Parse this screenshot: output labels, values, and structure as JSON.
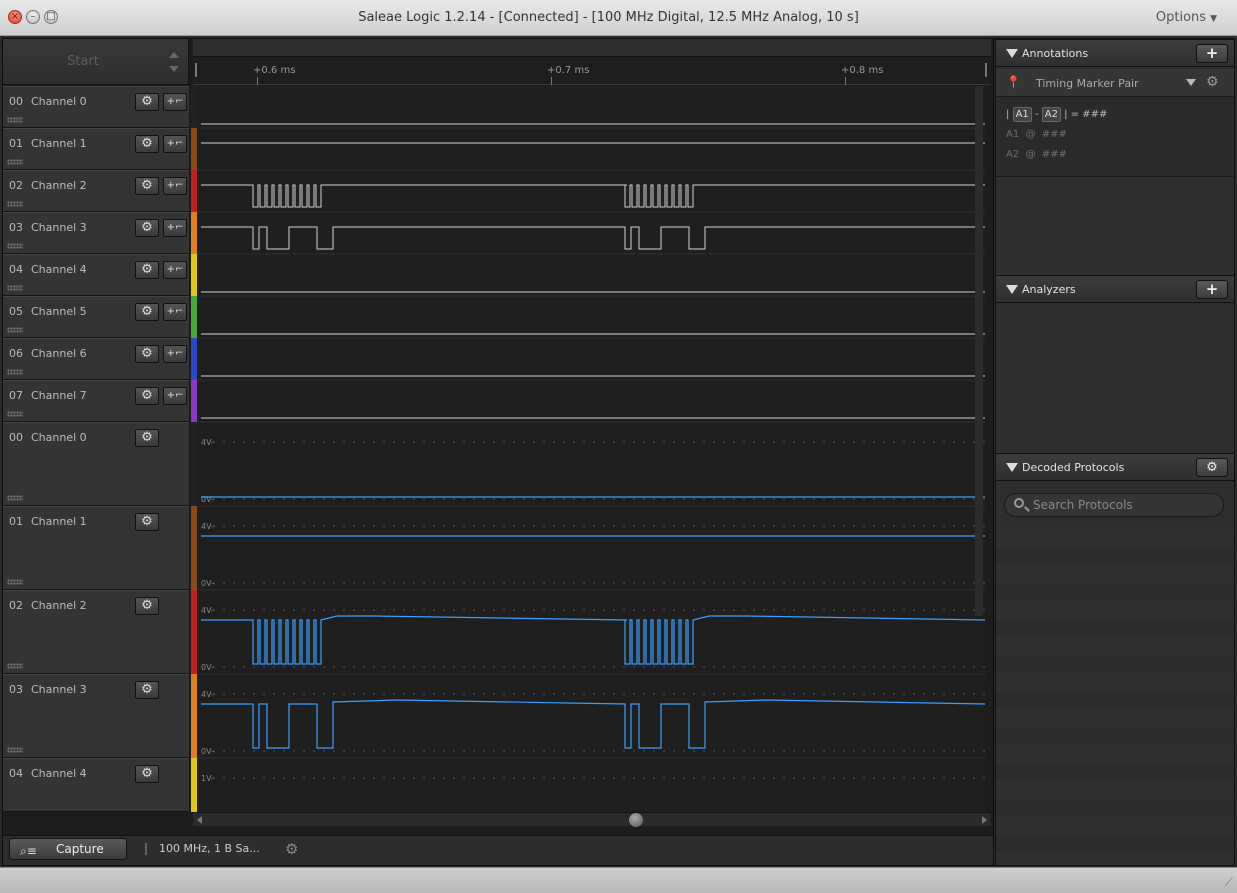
{
  "window": {
    "title": "Saleae Logic 1.2.14 - [Connected] - [100 MHz Digital, 12.5 MHz Analog, 10 s]",
    "options_label": "Options"
  },
  "start": {
    "label": "Start"
  },
  "ruler": {
    "ticks": [
      "+0.6 ms",
      "+0.7 ms",
      "+0.8 ms"
    ]
  },
  "digital_channels": [
    {
      "num": "00",
      "name": "Channel 0",
      "color": "#222222"
    },
    {
      "num": "01",
      "name": "Channel 1",
      "color": "#8a4a1a"
    },
    {
      "num": "02",
      "name": "Channel 2",
      "color": "#c02020"
    },
    {
      "num": "03",
      "name": "Channel 3",
      "color": "#e0801a"
    },
    {
      "num": "04",
      "name": "Channel 4",
      "color": "#e0c81a"
    },
    {
      "num": "05",
      "name": "Channel 5",
      "color": "#48a83a"
    },
    {
      "num": "06",
      "name": "Channel 6",
      "color": "#2c48c8"
    },
    {
      "num": "07",
      "name": "Channel 7",
      "color": "#8a3ac0"
    }
  ],
  "analog_channels": [
    {
      "num": "00",
      "name": "Channel 0",
      "color": "#222222",
      "top_label": "4V-",
      "bottom_label": "0V-"
    },
    {
      "num": "01",
      "name": "Channel 1",
      "color": "#8a4a1a",
      "top_label": "4V-",
      "bottom_label": "0V-"
    },
    {
      "num": "02",
      "name": "Channel 2",
      "color": "#c02020",
      "top_label": "4V-",
      "bottom_label": "0V-"
    },
    {
      "num": "03",
      "name": "Channel 3",
      "color": "#e0801a",
      "top_label": "4V-",
      "bottom_label": "0V-"
    },
    {
      "num": "04",
      "name": "Channel 4",
      "color": "#e0c81a",
      "top_label": "1V-",
      "bottom_label": ""
    }
  ],
  "bottom": {
    "capture_label": "Capture",
    "settings_summary": "100 MHz, 1 B Sa..."
  },
  "annotations": {
    "title": "Annotations",
    "marker_type": "Timing Marker Pair",
    "measure": {
      "a1": "A1",
      "a2": "A2",
      "value": "###"
    },
    "lines": [
      {
        "label": "A1",
        "at": "@",
        "value": "###"
      },
      {
        "label": "A2",
        "at": "@",
        "value": "###"
      }
    ]
  },
  "analyzers": {
    "title": "Analyzers"
  },
  "decoded": {
    "title": "Decoded Protocols",
    "search_placeholder": "Search Protocols"
  },
  "icons": [
    "close-icon",
    "minimize-icon",
    "maximize-icon",
    "gear-icon",
    "trigger-icon",
    "plus-icon",
    "pin-icon",
    "search-icon",
    "capture-icon"
  ]
}
